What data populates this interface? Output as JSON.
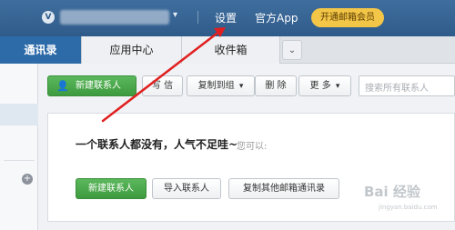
{
  "topbar": {
    "links": [
      "设置",
      "官方App"
    ],
    "vip_button": "开通邮箱会员"
  },
  "tabs": [
    "通讯录",
    "应用中心",
    "收件箱"
  ],
  "toolbar": {
    "new_contact": "新建联系人",
    "write_letter": "写 信",
    "copy_to_group": "复制到组",
    "delete": "删 除",
    "more": "更 多",
    "search_placeholder": "搜索所有联系人"
  },
  "content": {
    "empty_message": "一个联系人都没有，人气不足哇~",
    "hint": "您可以:",
    "actions": [
      "新建联系人",
      "导入联系人",
      "复制其他邮箱通讯录"
    ]
  },
  "watermark": {
    "text": "Bai 经验",
    "sub": "jingyan.baidu.com"
  },
  "colors": {
    "topbar": "#2f5b8a",
    "active_tab": "#2d6aa8",
    "primary_green": "#4cab4c",
    "vip_gold": "#f3c648",
    "annotation_arrow": "#e02020"
  }
}
